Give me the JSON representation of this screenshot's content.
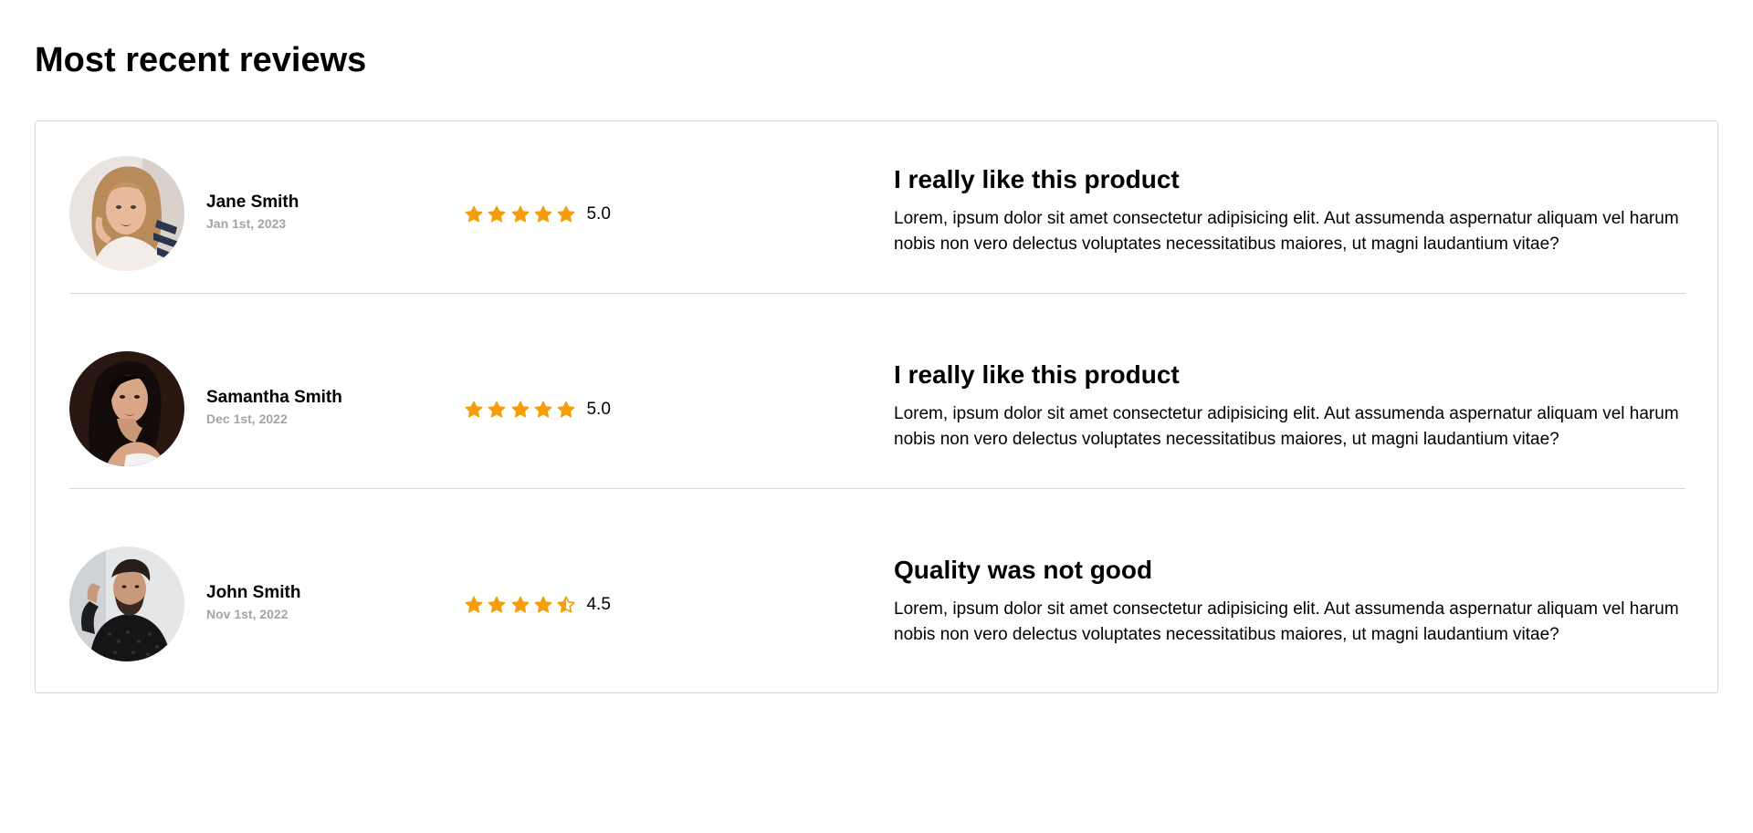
{
  "page": {
    "title": "Most recent reviews"
  },
  "colors": {
    "star": "#f59d0a",
    "divider": "#d8d8d8",
    "date_text": "#a4a4a4"
  },
  "reviews": [
    {
      "avatar_icon": "woman-portrait-avatar",
      "author": "Jane Smith",
      "date": "Jan 1st, 2023",
      "rating": 5.0,
      "rating_label": "5.0",
      "title": "I really like this product",
      "body": "Lorem, ipsum dolor sit amet consectetur adipisicing elit. Aut assumenda aspernatur aliquam vel harum nobis non vero delectus voluptates necessitatibus maiores, ut magni laudantium vitae?"
    },
    {
      "avatar_icon": "woman-portrait-avatar",
      "author": "Samantha Smith",
      "date": "Dec 1st, 2022",
      "rating": 5.0,
      "rating_label": "5.0",
      "title": "I really like this product",
      "body": "Lorem, ipsum dolor sit amet consectetur adipisicing elit. Aut assumenda aspernatur aliquam vel harum nobis non vero delectus voluptates necessitatibus maiores, ut magni laudantium vitae?"
    },
    {
      "avatar_icon": "man-portrait-avatar",
      "author": "John Smith",
      "date": "Nov 1st, 2022",
      "rating": 4.5,
      "rating_label": "4.5",
      "title": "Quality was not good",
      "body": "Lorem, ipsum dolor sit amet consectetur adipisicing elit. Aut assumenda aspernatur aliquam vel harum nobis non vero delectus voluptates necessitatibus maiores, ut magni laudantium vitae?"
    }
  ]
}
